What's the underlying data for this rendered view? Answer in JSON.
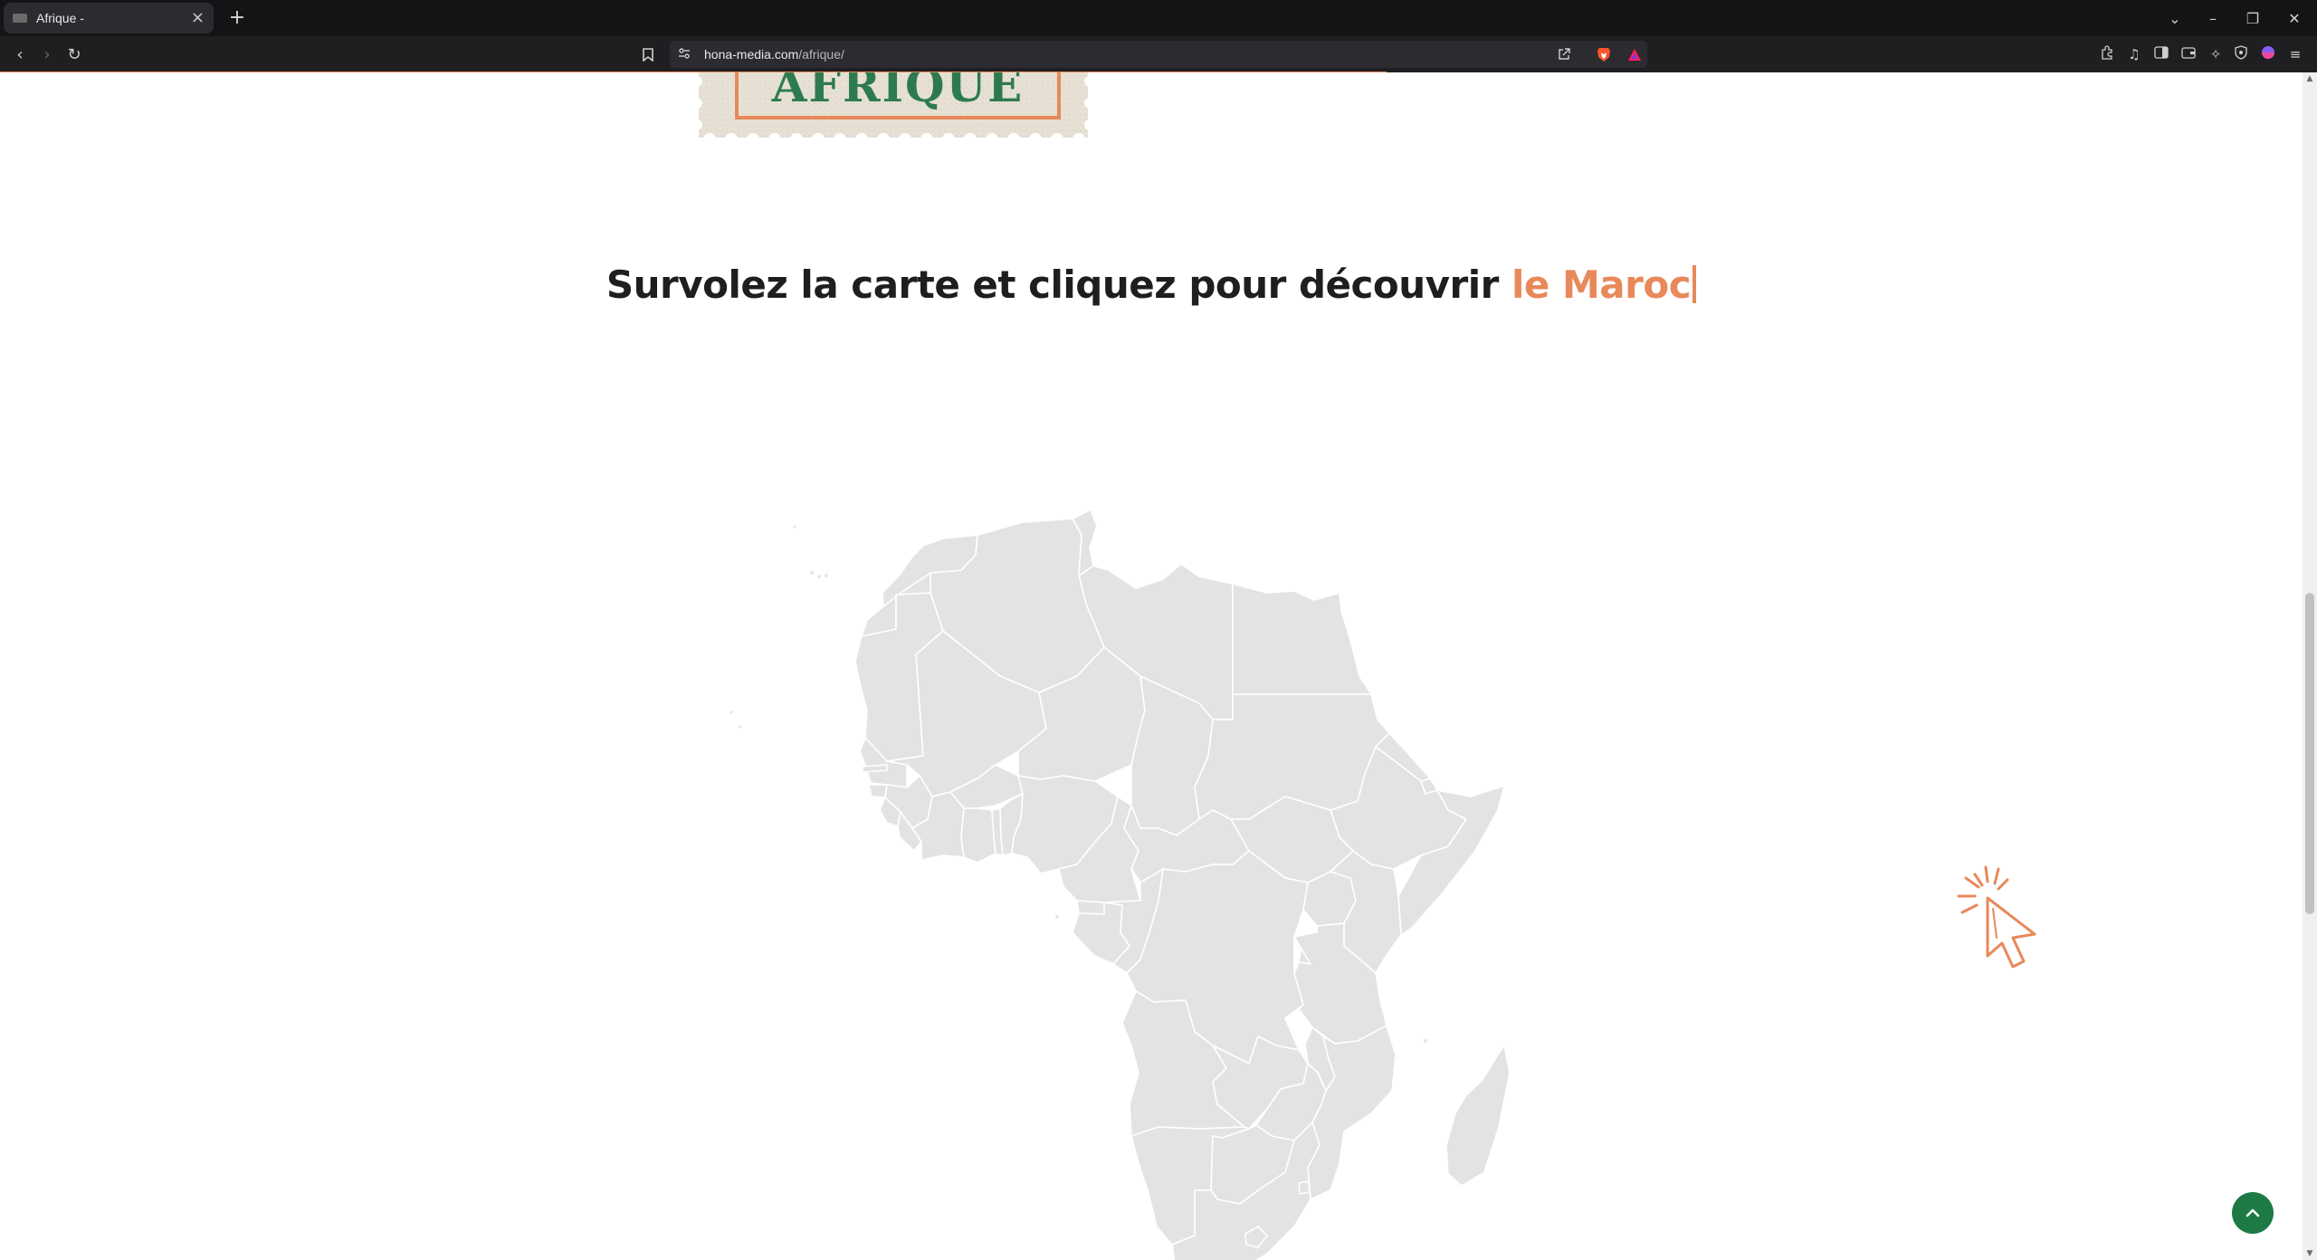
{
  "browser": {
    "tab_title": "Afrique -",
    "tab_close": "×",
    "new_tab": "+",
    "url_domain": "hona-media.com",
    "url_path": "/afrique/",
    "window_controls": {
      "tab_list": "⌄",
      "minimize": "–",
      "restore": "❐",
      "close": "✕"
    },
    "nav": {
      "back": "‹",
      "forward": "›",
      "reload": "↻"
    }
  },
  "page": {
    "stamp_text": "AFRIQUE",
    "headline_prefix": "Survolez la carte et cliquez pour découvrir ",
    "headline_accent": "le Maroc",
    "map_fill": "#e3e3e3",
    "map_border": "#ffffff",
    "accent_color": "#e8895a",
    "brand_green": "#1d7a45"
  },
  "icons": {
    "cursor_click": "cursor-click-icon",
    "back_to_top": "chevron-up-icon"
  }
}
